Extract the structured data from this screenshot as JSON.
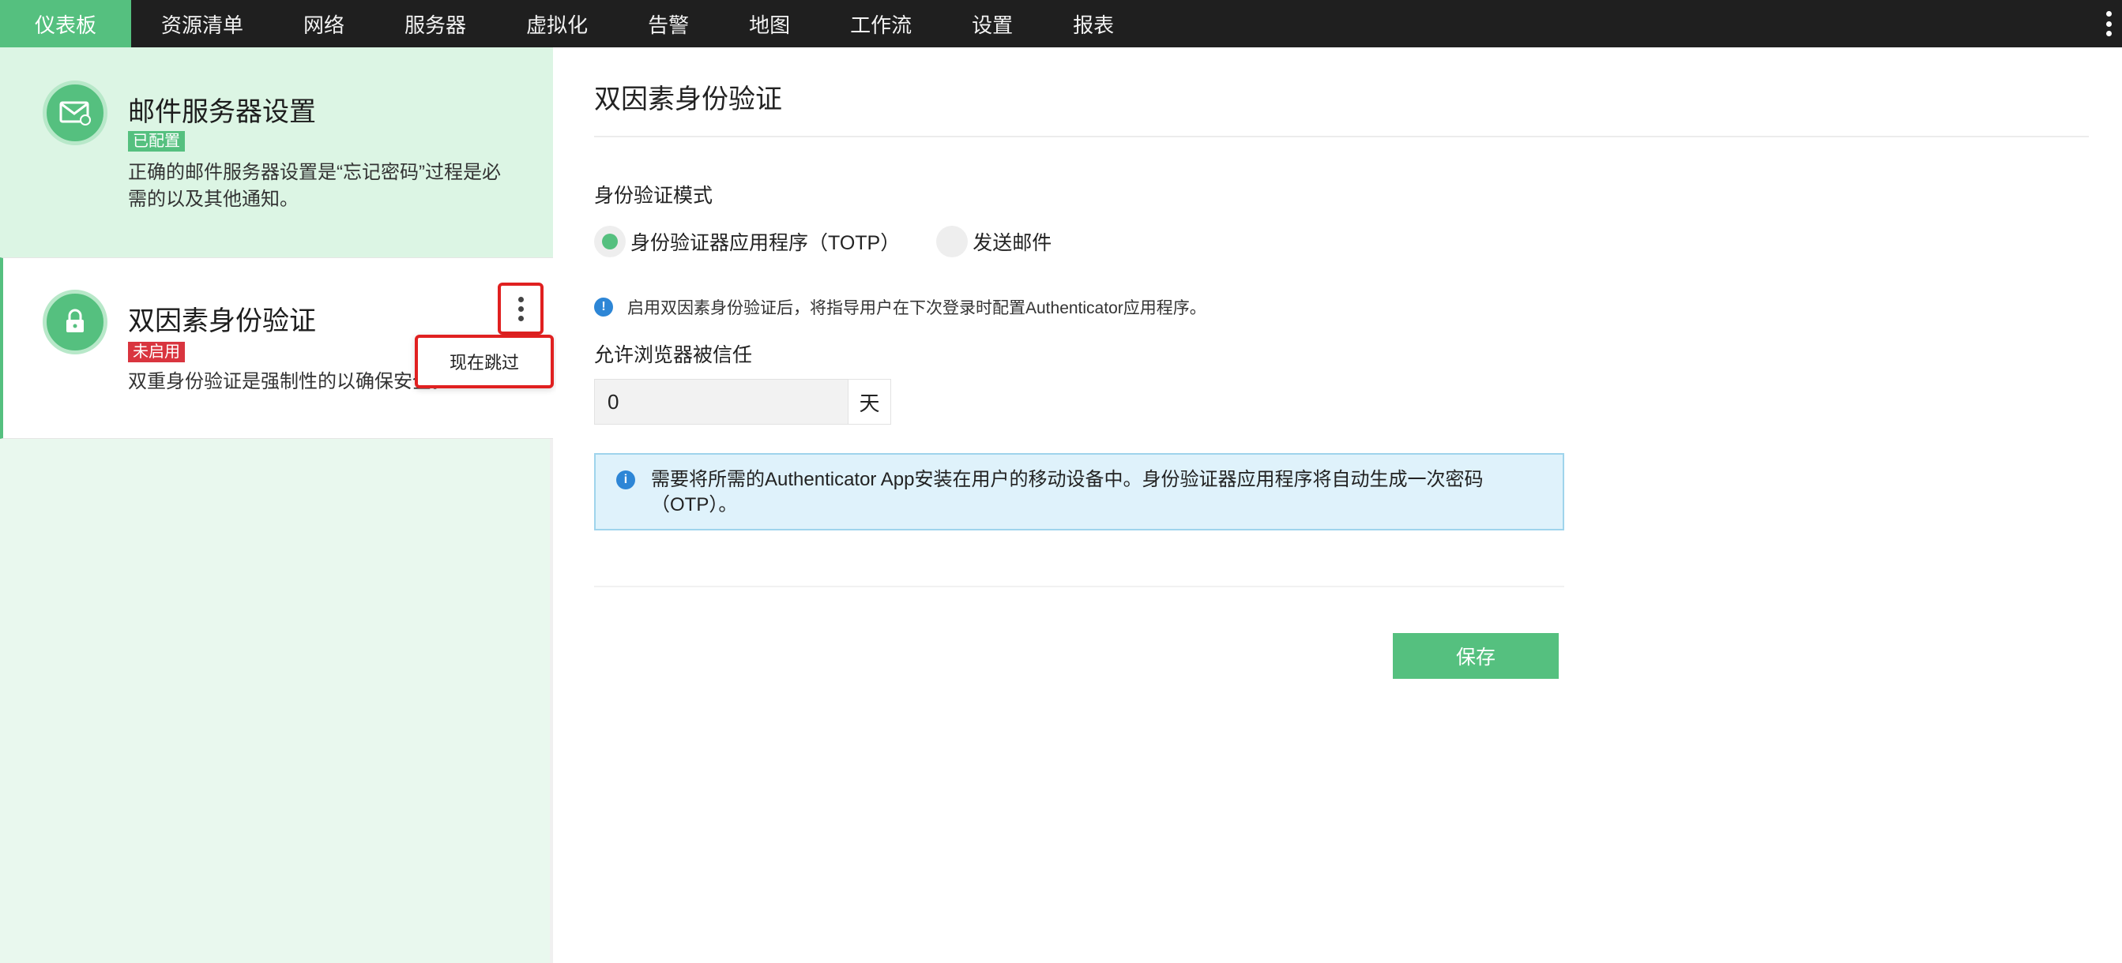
{
  "nav": {
    "items": [
      {
        "label": "仪表板",
        "active": true
      },
      {
        "label": "资源清单"
      },
      {
        "label": "网络"
      },
      {
        "label": "服务器"
      },
      {
        "label": "虚拟化"
      },
      {
        "label": "告警"
      },
      {
        "label": "地图"
      },
      {
        "label": "工作流"
      },
      {
        "label": "设置"
      },
      {
        "label": "报表"
      }
    ]
  },
  "sidebar": {
    "cards": [
      {
        "icon": "mail-settings-icon",
        "title": "邮件服务器设置",
        "badge": "已配置",
        "badge_color": "#55c07f",
        "desc_line1": "正确的邮件服务器设置是“忘记密码”过程是必",
        "desc_line2": "需的以及其他通知。"
      },
      {
        "icon": "lock-icon",
        "title": "双因素身份验证",
        "badge": "未启用",
        "badge_color": "#d9353f",
        "desc_line1": "双重身份验证是强制性的以确保安全。"
      }
    ],
    "popup_menu": {
      "item": "现在跳过"
    }
  },
  "main": {
    "title": "双因素身份验证",
    "auth_mode_label": "身份验证模式",
    "radio_options": [
      {
        "label": "身份验证器应用程序（TOTP）",
        "selected": true
      },
      {
        "label": "发送邮件",
        "selected": false
      }
    ],
    "hint": "启用双因素身份验证后，将指导用户在下次登录时配置Authenticator应用程序。",
    "trust_label": "允许浏览器被信任",
    "trust_value": "0",
    "trust_unit": "天",
    "info_text": "需要将所需的Authenticator App安装在用户的移动设备中。身份验证器应用程序将自动生成一次密码（OTP）。",
    "save_label": "保存"
  },
  "colors": {
    "accent": "#55c07f",
    "topbar": "#1f1f1f",
    "info_bg": "#dff2fb",
    "danger": "#d9353f"
  }
}
